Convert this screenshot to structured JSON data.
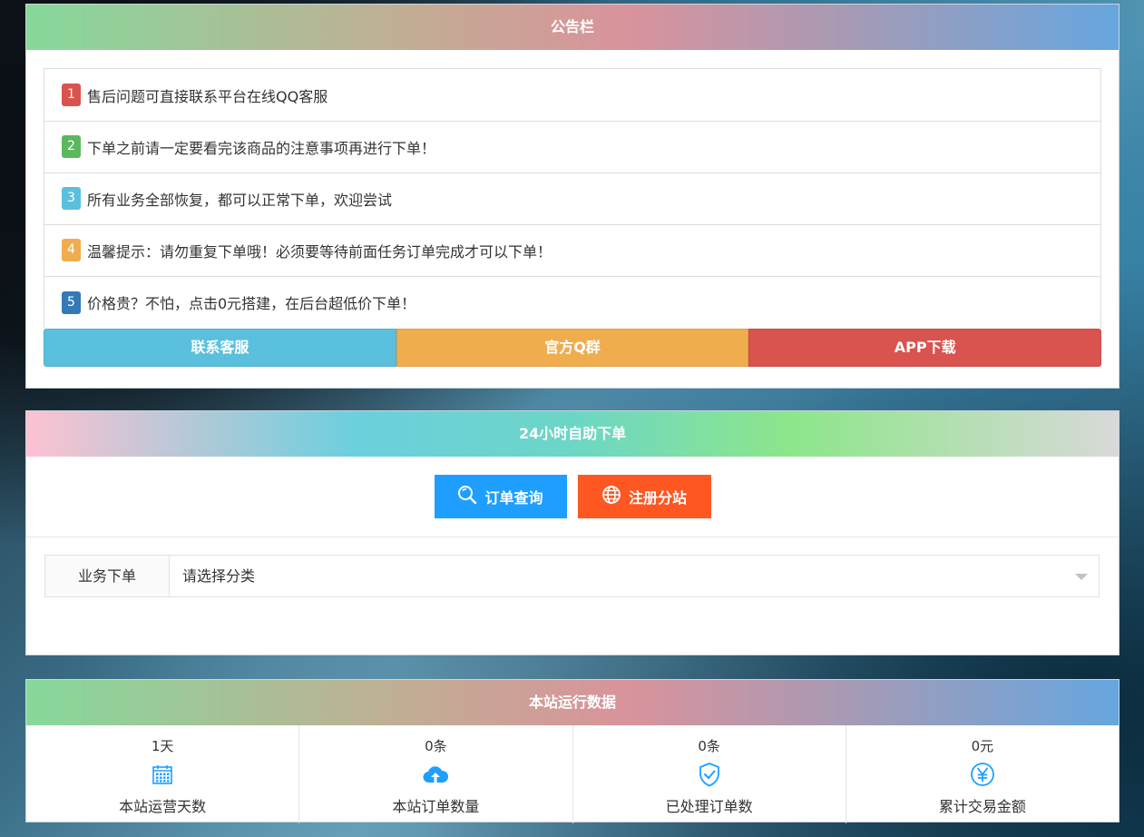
{
  "notice": {
    "title": "公告栏",
    "items": [
      {
        "num": "1",
        "text": "售后问题可直接联系平台在线QQ客服",
        "color": "#d9534f"
      },
      {
        "num": "2",
        "text": "下单之前请一定要看完该商品的注意事项再进行下单！",
        "color": "#5cb85c"
      },
      {
        "num": "3",
        "text": "所有业务全部恢复，都可以正常下单，欢迎尝试",
        "color": "#5bc0de"
      },
      {
        "num": "4",
        "text": "温馨提示：请勿重复下单哦！必须要等待前面任务订单完成才可以下单！",
        "color": "#f0ad4e"
      },
      {
        "num": "5",
        "text": "价格贵？不怕，点击0元搭建，在后台超低价下单！",
        "color": "#337ab7"
      }
    ],
    "buttons": {
      "contact": "联系客服",
      "qq_group": "官方Q群",
      "app": "APP下载"
    }
  },
  "order": {
    "title": "24小时自助下单",
    "query_button": "订单查询",
    "register_button": "注册分站",
    "select_label": "业务下单",
    "select_value": "请选择分类"
  },
  "stats": {
    "title": "本站运行数据",
    "items": [
      {
        "value": "1天",
        "label": "本站运营天数",
        "icon": "calendar-icon"
      },
      {
        "value": "0条",
        "label": "本站订单数量",
        "icon": "cloud-upload-icon"
      },
      {
        "value": "0条",
        "label": "已处理订单数",
        "icon": "shield-check-icon"
      },
      {
        "value": "0元",
        "label": "累计交易金额",
        "icon": "yen-icon"
      }
    ]
  },
  "colors": {
    "query_blue": "#1e9fff",
    "register_orange": "#ff5722",
    "icon_blue": "#1e9fff"
  }
}
